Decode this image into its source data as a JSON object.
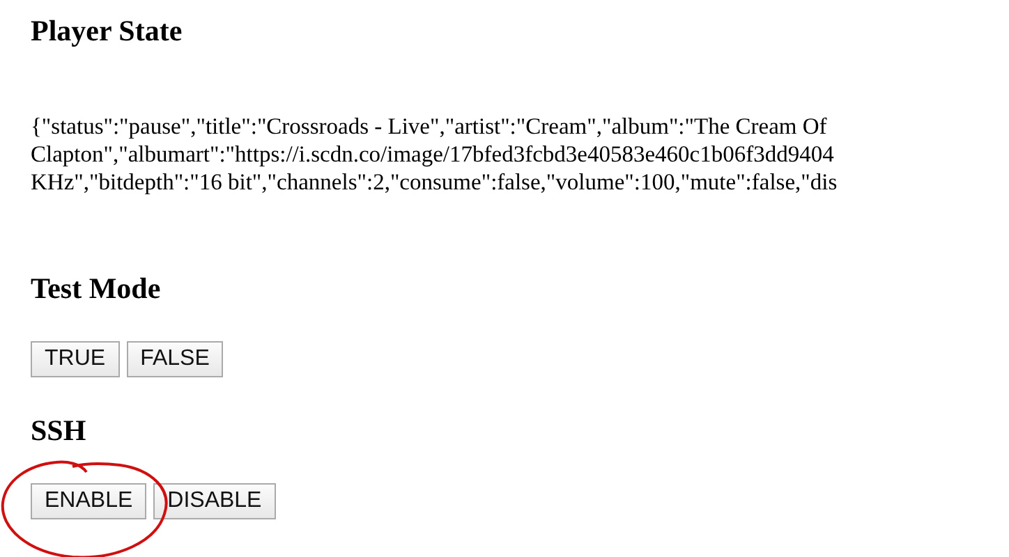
{
  "sections": [
    {
      "heading": "Player State",
      "state_lines": [
        "{\"status\":\"pause\",\"title\":\"Crossroads - Live\",\"artist\":\"Cream\",\"album\":\"The Cream Of",
        "Clapton\",\"albumart\":\"https://i.scdn.co/image/17bfed3fcbd3e40583e460c1b06f3dd9404",
        "KHz\",\"bitdepth\":\"16 bit\",\"channels\":2,\"consume\":false,\"volume\":100,\"mute\":false,\"dis"
      ]
    },
    {
      "heading": "Test Mode",
      "buttons": [
        "TRUE",
        "FALSE"
      ]
    },
    {
      "heading": "SSH",
      "buttons": [
        "ENABLE",
        "DISABLE"
      ],
      "circled": true
    }
  ]
}
